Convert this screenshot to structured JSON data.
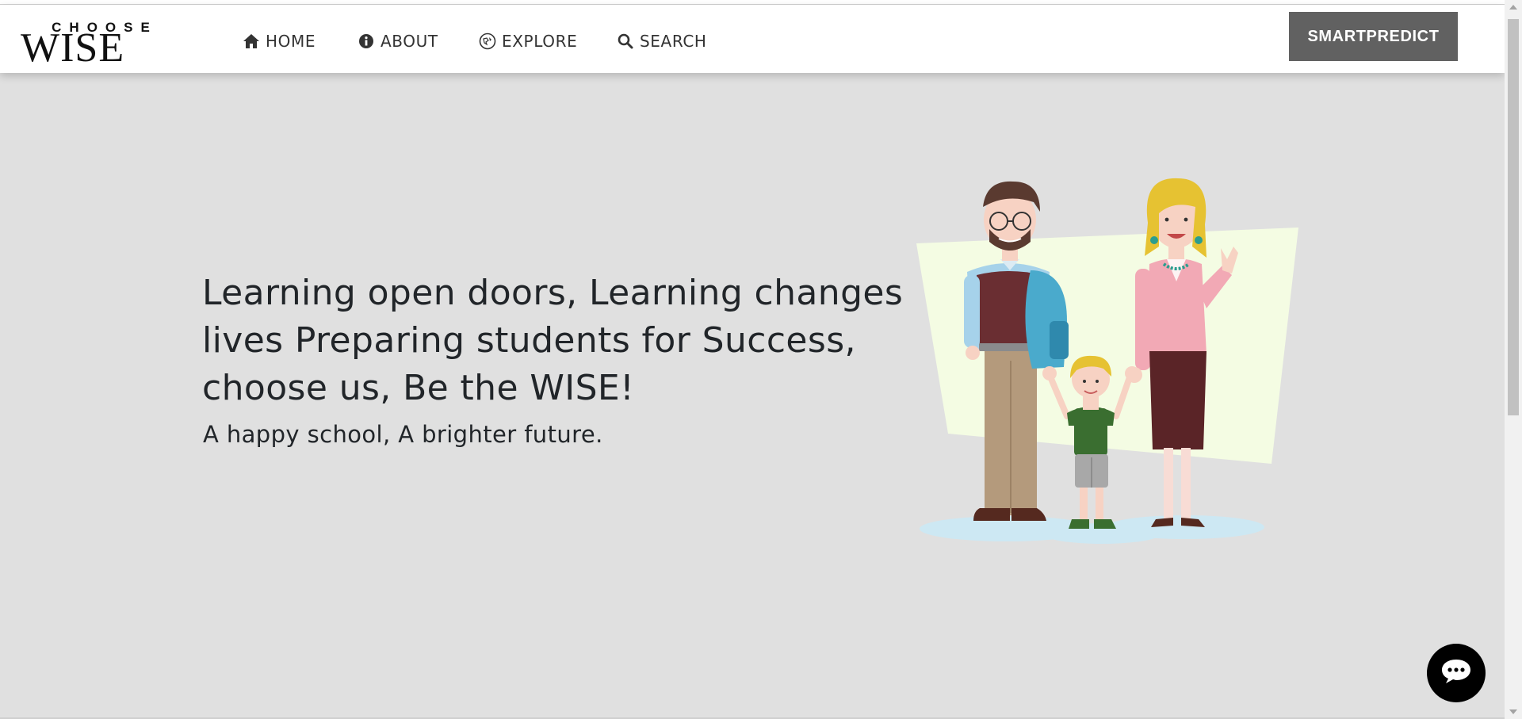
{
  "brand": {
    "logo_top": "CHOOSE",
    "logo_main": "WISE"
  },
  "nav": {
    "items": [
      {
        "label": "HOME",
        "icon": "home-icon"
      },
      {
        "label": "ABOUT",
        "icon": "info-icon"
      },
      {
        "label": "EXPLORE",
        "icon": "compass-icon"
      },
      {
        "label": "SEARCH",
        "icon": "search-icon"
      }
    ],
    "cta_label": "SMARTPREDICT"
  },
  "hero": {
    "title": "Learning open doors, Learning changes lives Preparing students for Success, choose us, Be the WISE!",
    "subtitle": "A happy school, A brighter future."
  },
  "colors": {
    "page_background": "#e0e0e0",
    "navbar_background": "#ffffff",
    "cta_background": "#616161",
    "chat_button": "#000000",
    "illustration_panel": "#f4fce3"
  },
  "chat": {
    "icon": "chat-bubble-icon"
  }
}
